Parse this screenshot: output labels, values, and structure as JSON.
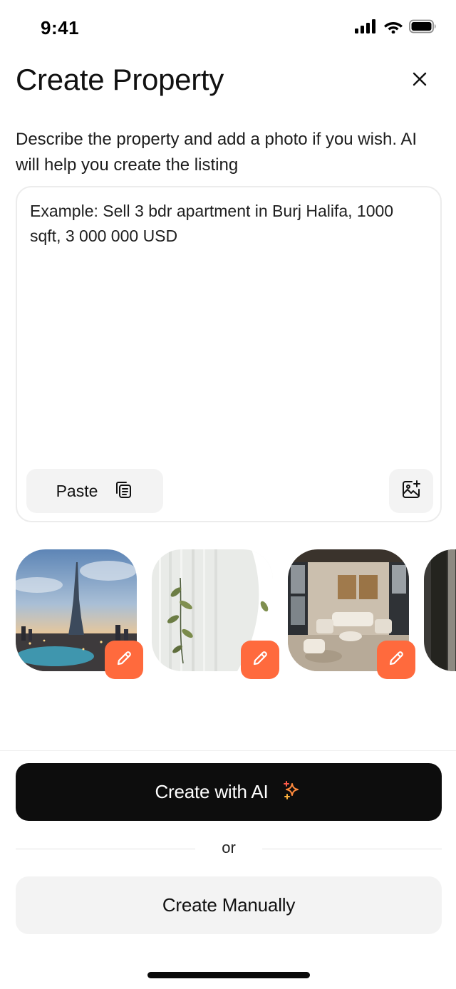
{
  "status_bar": {
    "time": "9:41",
    "icons": [
      "cellular-signal-icon",
      "wifi-icon",
      "battery-icon"
    ]
  },
  "header": {
    "title": "Create Property",
    "close_icon": "close-icon"
  },
  "subtitle": "Describe the property and add a photo if you wish. AI will help you create the listing",
  "description_input": {
    "value": "",
    "placeholder": "Example: Sell 3 bdr apartment in Burj Halifa, 1000 sqft, 3 000 000 USD"
  },
  "paste_button": {
    "label": "Paste",
    "icon": "copy-icon"
  },
  "add_image_button": {
    "icon": "image-add-icon"
  },
  "photos": [
    {
      "subject": "burj-khalifa-skyline",
      "edit_icon": "pencil-icon"
    },
    {
      "subject": "plant-and-curtain",
      "edit_icon": "pencil-icon"
    },
    {
      "subject": "living-room-interior",
      "edit_icon": "pencil-icon"
    },
    {
      "subject": "dark-interior-partial"
    }
  ],
  "actions": {
    "ai_button_label": "Create with AI",
    "ai_button_icon": "sparkles-icon",
    "or_text": "or",
    "manual_button_label": "Create Manually"
  },
  "colors": {
    "accent": "#ff6a3d",
    "primary_button": "#0d0d0d",
    "secondary_button": "#f3f3f3",
    "border": "#ececec"
  }
}
